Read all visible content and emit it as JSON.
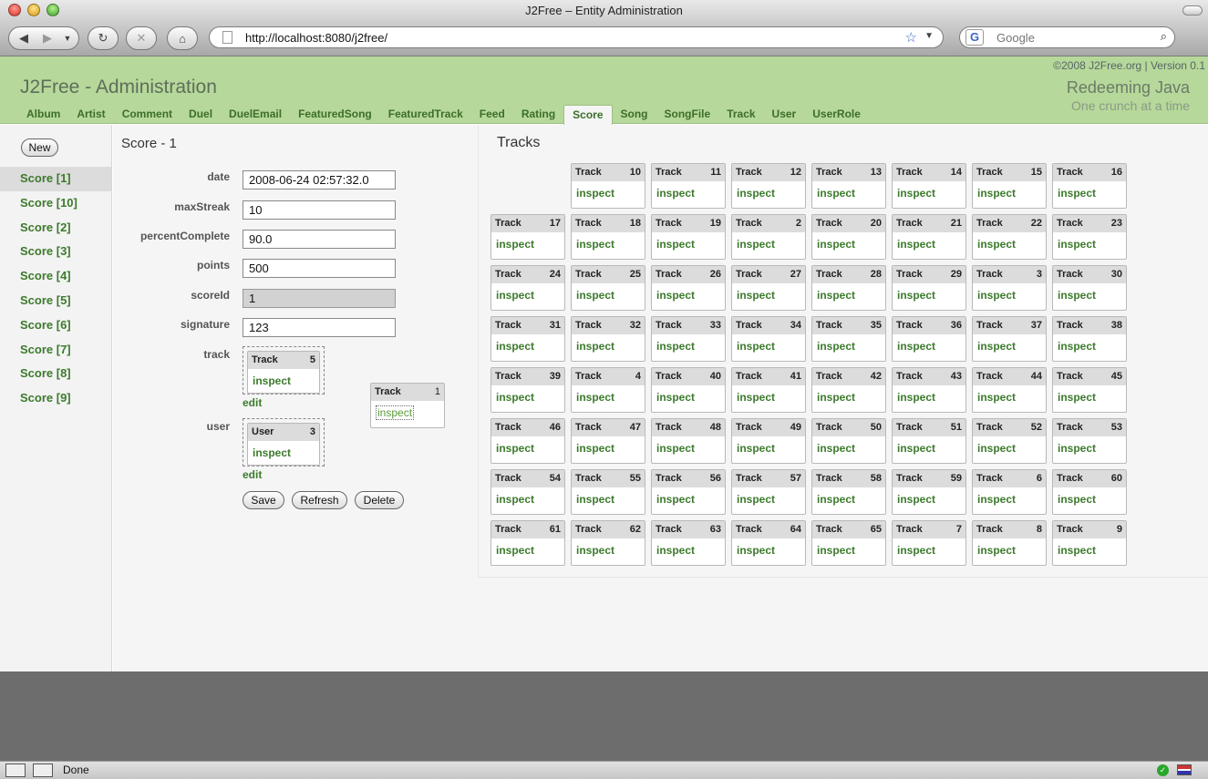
{
  "window": {
    "title": "J2Free – Entity Administration"
  },
  "browser": {
    "url": "http://localhost:8080/j2free/",
    "search_placeholder": "Google",
    "status": "Done"
  },
  "app": {
    "copyright": "©2008 J2Free.org | Version 0.1",
    "title": "J2Free - Administration",
    "slogan": "Redeeming Java",
    "tagline": "One crunch at a time",
    "tabs": [
      {
        "label": "Album"
      },
      {
        "label": "Artist"
      },
      {
        "label": "Comment"
      },
      {
        "label": "Duel"
      },
      {
        "label": "DuelEmail"
      },
      {
        "label": "FeaturedSong"
      },
      {
        "label": "FeaturedTrack"
      },
      {
        "label": "Feed"
      },
      {
        "label": "Rating"
      },
      {
        "label": "Score"
      },
      {
        "label": "Song"
      },
      {
        "label": "SongFile"
      },
      {
        "label": "Track"
      },
      {
        "label": "User"
      },
      {
        "label": "UserRole"
      }
    ],
    "active_tab": "Score"
  },
  "sidebar": {
    "new_label": "New",
    "items": [
      {
        "label": "Score [1]"
      },
      {
        "label": "Score [10]"
      },
      {
        "label": "Score [2]"
      },
      {
        "label": "Score [3]"
      },
      {
        "label": "Score [4]"
      },
      {
        "label": "Score [5]"
      },
      {
        "label": "Score [6]"
      },
      {
        "label": "Score [7]"
      },
      {
        "label": "Score [8]"
      },
      {
        "label": "Score [9]"
      }
    ]
  },
  "form": {
    "title": "Score - 1",
    "fields": [
      {
        "label": "date",
        "value": "2008-06-24 02:57:32.0"
      },
      {
        "label": "maxStreak",
        "value": "10"
      },
      {
        "label": "percentComplete",
        "value": "90.0"
      },
      {
        "label": "points",
        "value": "500"
      },
      {
        "label": "scoreId",
        "value": "1"
      },
      {
        "label": "signature",
        "value": "123"
      }
    ],
    "track": {
      "label": "track",
      "entity": "Track",
      "id": "5",
      "link": "inspect",
      "edit": "edit"
    },
    "user": {
      "label": "user",
      "entity": "User",
      "id": "3",
      "link": "inspect",
      "edit": "edit"
    },
    "floating_card": {
      "entity": "Track",
      "id": "1",
      "link": "inspect"
    },
    "buttons": {
      "save": "Save",
      "refresh": "Refresh",
      "delete": "Delete"
    }
  },
  "tracks": {
    "title": "Tracks",
    "entity": "Track",
    "link": "inspect",
    "ids": [
      "10",
      "11",
      "12",
      "13",
      "14",
      "15",
      "16",
      "17",
      "18",
      "19",
      "2",
      "20",
      "21",
      "22",
      "23",
      "24",
      "25",
      "26",
      "27",
      "28",
      "29",
      "3",
      "30",
      "31",
      "32",
      "33",
      "34",
      "35",
      "36",
      "37",
      "38",
      "39",
      "4",
      "40",
      "41",
      "42",
      "43",
      "44",
      "45",
      "46",
      "47",
      "48",
      "49",
      "50",
      "51",
      "52",
      "53",
      "54",
      "55",
      "56",
      "57",
      "58",
      "59",
      "6",
      "60",
      "61",
      "62",
      "63",
      "64",
      "65",
      "7",
      "8",
      "9"
    ]
  }
}
